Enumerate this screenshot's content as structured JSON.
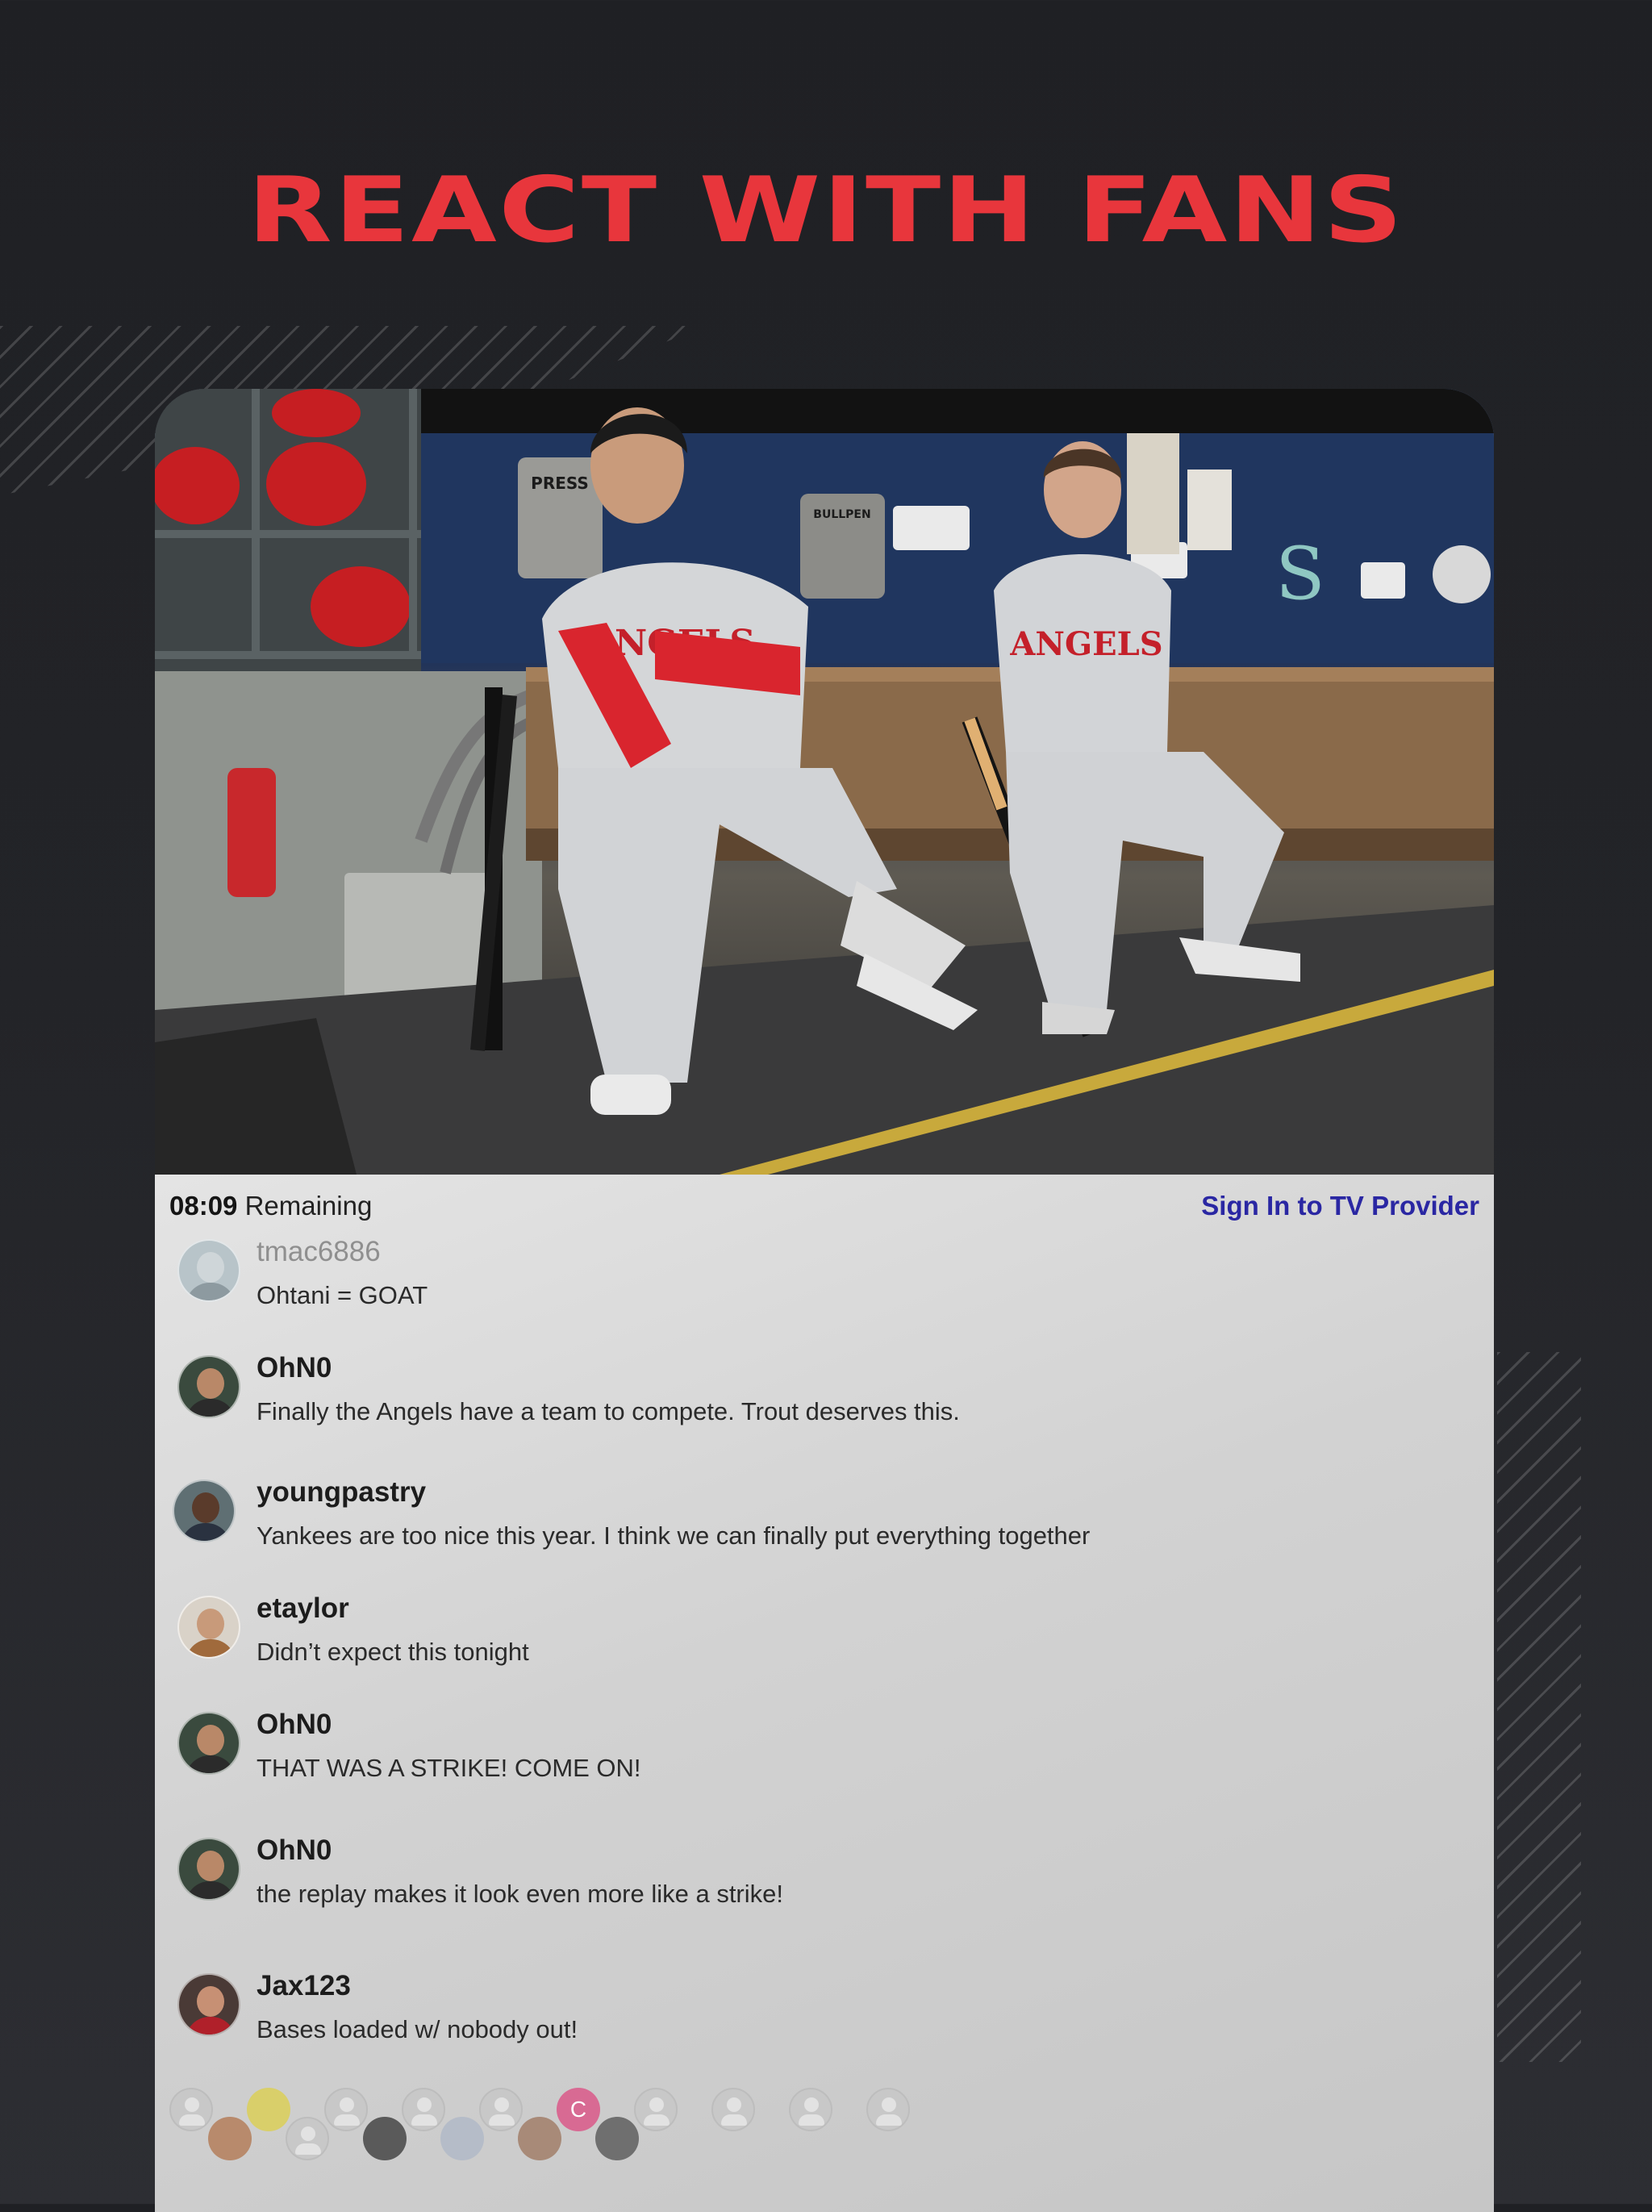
{
  "headline": "REACT WITH FANS",
  "status": {
    "time": "08:09",
    "remaining_label": "Remaining",
    "signin_label": "Sign In to TV Provider"
  },
  "messages": [
    {
      "user": "tmac6886",
      "text": "Ohtani = GOAT"
    },
    {
      "user": "OhN0",
      "text": "Finally the Angels have a team to compete. Trout deserves this."
    },
    {
      "user": "youngpastry",
      "text": "Yankees are too nice this year. I think we can finally put everything together"
    },
    {
      "user": "etaylor",
      "text": "Didn’t expect this tonight"
    },
    {
      "user": "OhN0",
      "text": "THAT WAS A STRIKE! COME ON!"
    },
    {
      "user": "OhN0",
      "text": "the replay makes it look even more like a strike!"
    },
    {
      "user": "Jax123",
      "text": "Bases loaded w/ nobody out!"
    }
  ],
  "viewers": {
    "initial": "C"
  },
  "photo_signs": {
    "press": "PRESS",
    "bullpen": "BULLPEN",
    "jersey": "ANGELS"
  },
  "colors": {
    "accent": "#e8363c",
    "link": "#2a27a3",
    "background": "#222327"
  }
}
